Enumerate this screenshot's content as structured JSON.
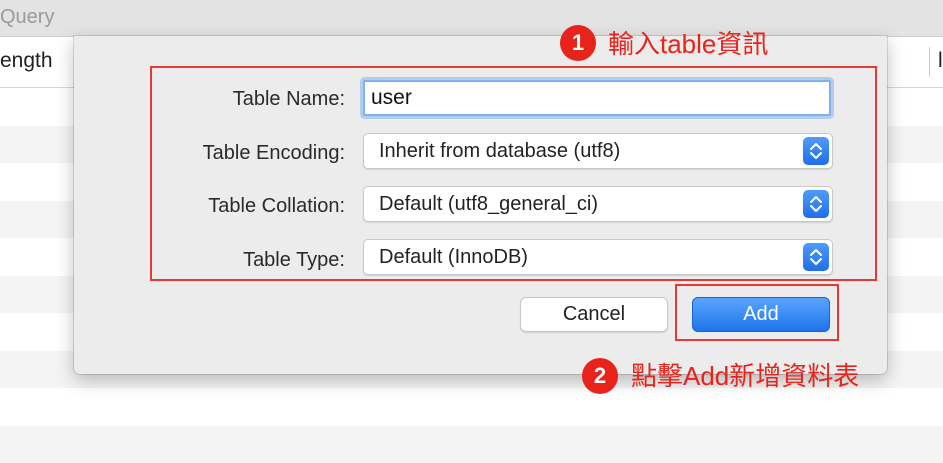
{
  "app": {
    "window_title": "Query",
    "column_header_left": "ength",
    "column_header_right": "l"
  },
  "dialog": {
    "table_name": {
      "label": "Table Name:",
      "value": "user"
    },
    "table_encoding": {
      "label": "Table Encoding:",
      "value": "Inherit from database (utf8)"
    },
    "table_collation": {
      "label": "Table Collation:",
      "value": "Default (utf8_general_ci)"
    },
    "table_type": {
      "label": "Table Type:",
      "value": "Default (InnoDB)"
    },
    "cancel_label": "Cancel",
    "add_label": "Add"
  },
  "annotations": {
    "step1": {
      "number": "1",
      "text": "輸入table資訊"
    },
    "step2": {
      "number": "2",
      "text": "點擊Add新增資料表"
    },
    "color": "#e8231c"
  },
  "colors": {
    "accent_blue": "#1e74ea",
    "focus_ring": "#7fb0f0",
    "highlight_red": "#e53935"
  }
}
